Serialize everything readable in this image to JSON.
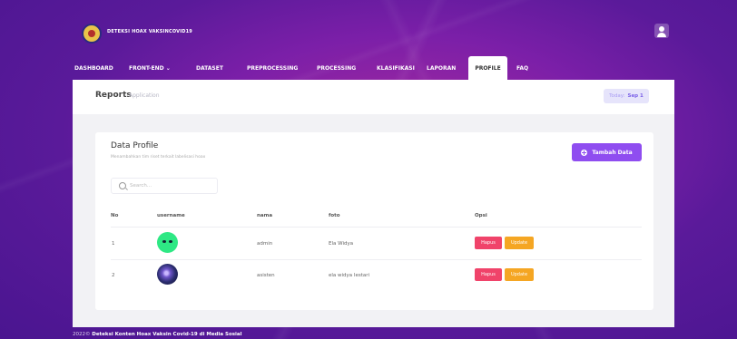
{
  "brand": {
    "name": "DETEKSI HOAX VAKSINCOVID19"
  },
  "nav": {
    "items": [
      {
        "label": "DASHBOARD"
      },
      {
        "label": "FRONT-END ⌄"
      },
      {
        "label": "DATASET"
      },
      {
        "label": "PREPROCESSING"
      },
      {
        "label": "PROCESSING"
      },
      {
        "label": "KLASIFIKASI"
      },
      {
        "label": "LAPORAN"
      },
      {
        "label": "PROFILE",
        "active": true
      },
      {
        "label": "FAQ"
      }
    ]
  },
  "reports": {
    "title": "Reports",
    "subtitle": "Application",
    "today_label": "Today:",
    "today_value": "Sep 1"
  },
  "card": {
    "title": "Data Profile",
    "subtitle": "Menambahkan tim riset terkait labelisasi hoax",
    "add_button": "Tambah Data",
    "search_placeholder": "Search..."
  },
  "table": {
    "headers": [
      "No",
      "username",
      "nama",
      "foto",
      "Opsi"
    ],
    "rows": [
      {
        "no": "1",
        "avatar": "green-face-avatar",
        "nama": "admin",
        "foto": "Ela Widya",
        "hapus": "Hapus",
        "update": "Update"
      },
      {
        "no": "2",
        "avatar": "space-galaxy-avatar",
        "nama": "asisten",
        "foto": "ela widya lestari",
        "hapus": "Hapus",
        "update": "Update"
      }
    ]
  },
  "footer": {
    "year": "2022©",
    "text": "Deteksi Konten Hoax Vaksin Covid-19 di Media Sosial"
  },
  "colors": {
    "accent": "#8f4df0",
    "danger": "#f0436a",
    "warning": "#f5a623",
    "background": "#7b1fa8"
  }
}
